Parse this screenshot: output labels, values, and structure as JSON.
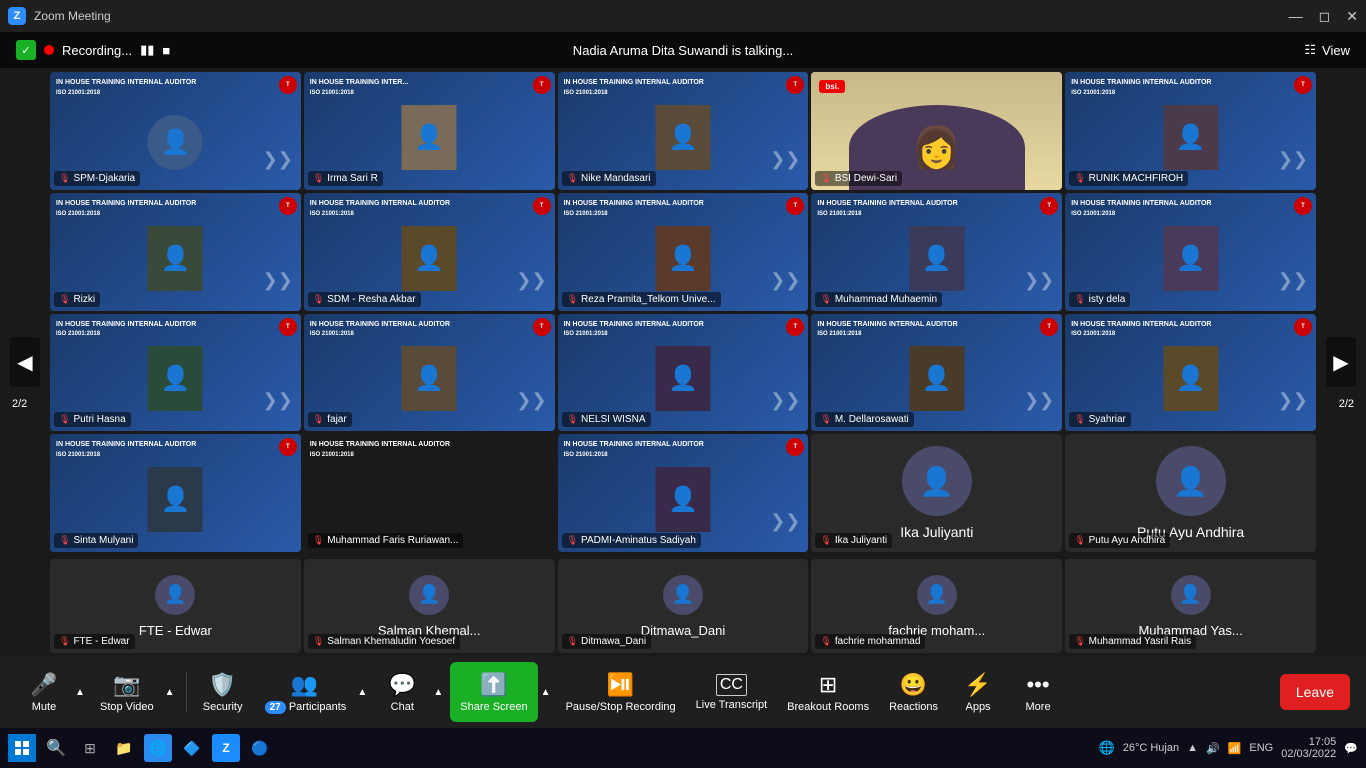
{
  "window": {
    "title": "Zoom Meeting",
    "recording_text": "Recording...",
    "talking_indicator": "Nadia Aruma Dita Suwandi is talking...",
    "view_label": "View"
  },
  "navigation": {
    "left_page": "2/2",
    "right_page": "2/2"
  },
  "participants": [
    {
      "name": "SPM-Djakaria",
      "has_video": true,
      "row": 0,
      "col": 0
    },
    {
      "name": "Irma Sari R",
      "has_video": true,
      "row": 0,
      "col": 1
    },
    {
      "name": "Nike Mandasari",
      "has_video": true,
      "row": 0,
      "col": 2
    },
    {
      "name": "BSI Dewi-Sari",
      "has_video": true,
      "row": 0,
      "col": 3,
      "is_bsi": true
    },
    {
      "name": "RUNIK MACHFIROH",
      "has_video": true,
      "row": 0,
      "col": 4
    },
    {
      "name": "Rizki",
      "has_video": true,
      "row": 1,
      "col": 0
    },
    {
      "name": "SDM - Resha Akbar",
      "has_video": true,
      "row": 1,
      "col": 1
    },
    {
      "name": "Reza Pramita_Telkom Unive...",
      "has_video": true,
      "row": 1,
      "col": 2
    },
    {
      "name": "Muhammad Muhaemin",
      "has_video": true,
      "row": 1,
      "col": 3
    },
    {
      "name": "isty dela",
      "has_video": true,
      "row": 1,
      "col": 4
    },
    {
      "name": "Putri Hasna",
      "has_video": true,
      "row": 2,
      "col": 0
    },
    {
      "name": "fajar",
      "has_video": true,
      "row": 2,
      "col": 1
    },
    {
      "name": "NELSI WISNA",
      "has_video": true,
      "row": 2,
      "col": 2
    },
    {
      "name": "M. Dellarosawati",
      "has_video": true,
      "row": 2,
      "col": 3
    },
    {
      "name": "Syahriar",
      "has_video": true,
      "row": 2,
      "col": 4
    },
    {
      "name": "Sinta Mulyani",
      "has_video": true,
      "row": 3,
      "col": 0
    },
    {
      "name": "Muhammad Faris Ruriawan...",
      "has_video": true,
      "row": 3,
      "col": 1
    },
    {
      "name": "PADMI-Aminatus Sadiyah",
      "has_video": true,
      "row": 3,
      "col": 2
    },
    {
      "name": "Ika Juliyanti",
      "has_video": false,
      "row": 3,
      "col": 3,
      "sub_name": "Ika Juliyanti"
    },
    {
      "name": "Putu Ayu Andhira",
      "has_video": false,
      "row": 3,
      "col": 4,
      "sub_name": "Putu Ayu Andhira"
    }
  ],
  "bottom_row": [
    {
      "name": "FTE - Edwar",
      "sub": "FTE - Edwar"
    },
    {
      "name": "Salman Khemal...",
      "sub": "Salman Khemaludin Yoesoef"
    },
    {
      "name": "Ditmawa_Dani",
      "sub": "Ditmawa_Dani"
    },
    {
      "name": "fachrie moham...",
      "sub": "fachrie mohammad"
    },
    {
      "name": "Muhammad Yas...",
      "sub": "Muhammad Yasril Rais"
    }
  ],
  "toolbar": {
    "mute_label": "Mute",
    "stop_video_label": "Stop Video",
    "security_label": "Security",
    "participants_label": "Participants",
    "participants_count": "27",
    "chat_label": "Chat",
    "share_screen_label": "Share Screen",
    "pause_recording_label": "Pause/Stop Recording",
    "live_transcript_label": "Live Transcript",
    "breakout_rooms_label": "Breakout Rooms",
    "reactions_label": "Reactions",
    "apps_label": "Apps",
    "more_label": "More",
    "leave_label": "Leave"
  },
  "system_tray": {
    "time": "17:05",
    "date": "02/03/2022",
    "temp": "26°C",
    "weather": "Hujan",
    "lang": "ENG"
  },
  "training": {
    "line1": "IN HOUSE TRAINING INTERNAL AUDITOR",
    "line2": "ISO 21001:2018"
  }
}
